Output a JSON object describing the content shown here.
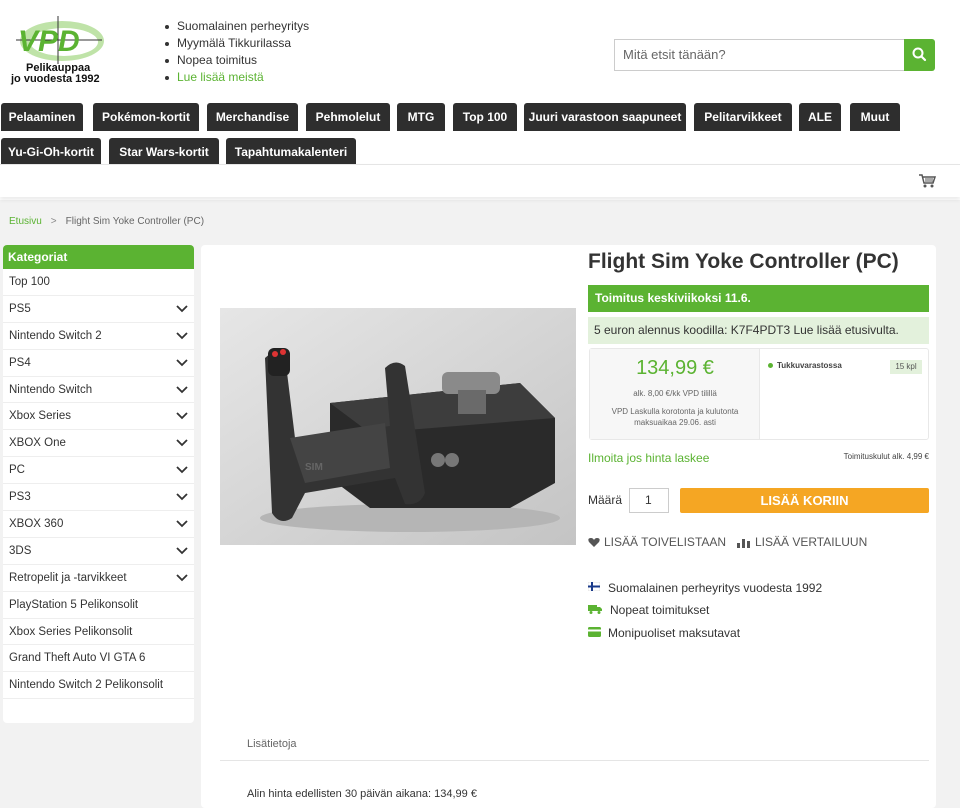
{
  "logo": {
    "line1": "Pelikauppaa",
    "line2": "jo vuodesta 1992",
    "brand": "VPD"
  },
  "usp": [
    "Suomalainen perheyritys",
    "Myymälä Tikkurilassa",
    "Nopea toimitus"
  ],
  "usp_link": "Lue lisää meistä",
  "search": {
    "placeholder": "Mitä etsit tänään?"
  },
  "nav": [
    "Pelaaminen",
    "Pokémon-kortit",
    "Merchandise",
    "Pehmolelut",
    "MTG",
    "Top 100",
    "Juuri varastoon saapuneet",
    "Pelitarvikkeet",
    "ALE",
    "Muut",
    "Yu-Gi-Oh-kortit",
    "Star Wars-kortit",
    "Tapahtumakalenteri"
  ],
  "breadcrumb": {
    "home": "Etusivu",
    "sep": ">",
    "current": "Flight Sim Yoke Controller (PC)"
  },
  "sidebar": {
    "title": "Kategoriat",
    "items": [
      {
        "label": "Top 100",
        "expandable": false
      },
      {
        "label": "PS5",
        "expandable": true
      },
      {
        "label": "Nintendo Switch 2",
        "expandable": true
      },
      {
        "label": "PS4",
        "expandable": true
      },
      {
        "label": "Nintendo Switch",
        "expandable": true
      },
      {
        "label": "Xbox Series",
        "expandable": true
      },
      {
        "label": "XBOX One",
        "expandable": true
      },
      {
        "label": "PC",
        "expandable": true
      },
      {
        "label": "PS3",
        "expandable": true
      },
      {
        "label": "XBOX 360",
        "expandable": true
      },
      {
        "label": "3DS",
        "expandable": true
      },
      {
        "label": "Retropelit ja -tarvikkeet",
        "expandable": true
      },
      {
        "label": "PlayStation 5 Pelikonsolit",
        "expandable": false
      },
      {
        "label": "Xbox Series Pelikonsolit",
        "expandable": false
      },
      {
        "label": "Grand Theft Auto VI GTA 6",
        "expandable": false
      },
      {
        "label": "Nintendo Switch 2 Pelikonsolit",
        "expandable": false
      }
    ]
  },
  "product": {
    "title": "Flight Sim Yoke Controller (PC)",
    "delivery": "Toimitus keskiviikoksi 11.6.",
    "promo": "5 euron alennus koodilla: K7F4PDT3 Lue lisää etusivulta.",
    "price": "134,99 €",
    "per_month": "alk. 8,00 €/kk VPD tilillä",
    "credit": "VPD Laskulla korotonta ja kulutonta maksuaikaa 29.06. asti",
    "stock": "Tukkuvarastossa",
    "stock_qty": "15 kpl",
    "notify": "Ilmoita jos hinta laskee",
    "shipping": "Toimituskulut alk. 4,99 €",
    "qty_label": "Määrä",
    "qty_value": "1",
    "add_to_cart": "LISÄÄ KORIIN",
    "wishlist": "LISÄÄ TOIVELISTAAN",
    "compare": "LISÄÄ VERTAILUUN",
    "features": [
      "Suomalainen perheyritys vuodesta 1992",
      "Nopeat toimitukset",
      "Monipuoliset maksutavat"
    ],
    "info_tab": "Lisätietoja",
    "lowest_price": "Alin hinta edellisten 30 päivän aikana: 134,99 €"
  },
  "colors": {
    "accent": "#5bb332",
    "nav": "#2e2e2e",
    "cart_button": "#f5a623"
  }
}
